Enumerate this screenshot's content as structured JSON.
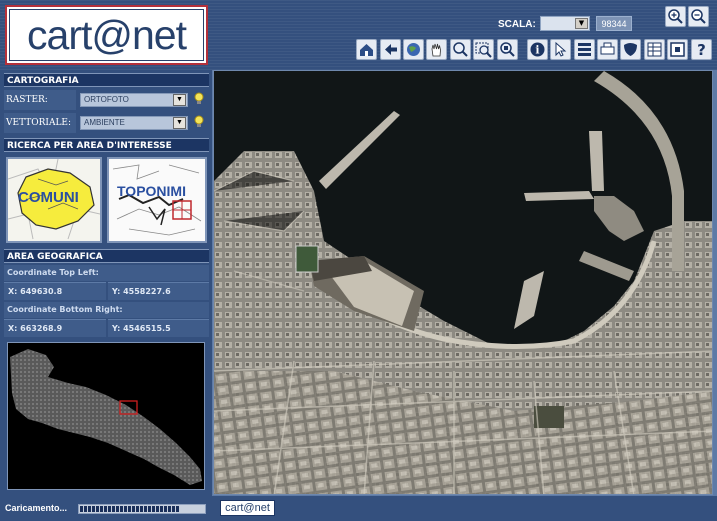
{
  "header": {
    "logo_text": "cart@net",
    "scale_label": "SCALA:",
    "scale_value": "98344",
    "toolbar": [
      {
        "name": "home-icon"
      },
      {
        "name": "back-arrow-icon"
      },
      {
        "name": "globe-icon"
      },
      {
        "name": "pan-hand-icon"
      },
      {
        "name": "zoom-icon"
      },
      {
        "name": "zoom-window-icon"
      },
      {
        "name": "zoom-extent-icon"
      },
      {
        "name": "info-icon"
      },
      {
        "name": "select-icon"
      },
      {
        "name": "legend-icon"
      },
      {
        "name": "print-icon"
      },
      {
        "name": "shield-icon"
      },
      {
        "name": "table-icon"
      },
      {
        "name": "window-icon"
      },
      {
        "name": "help-icon"
      }
    ]
  },
  "cartografia": {
    "title": "CARTOGRAFIA",
    "raster_label": "RASTER:",
    "raster_value": "ORTOFOTO",
    "vettoriale_label": "VETTORIALE:",
    "vettoriale_value": "AMBIENTE"
  },
  "ricerca": {
    "title": "RICERCA PER AREA D'INTERESSE",
    "comuni_label": "COMUNI",
    "toponimi_label": "TOPONIMI"
  },
  "area": {
    "title": "AREA GEOGRAFICA",
    "top_left_label": "Coordinate Top Left:",
    "tl_x": "X: 649630.8",
    "tl_y": "Y: 4558227.6",
    "bottom_right_label": "Coordinate Bottom Right:",
    "br_x": "X: 663268.9",
    "br_y": "Y: 4546515.5"
  },
  "status": {
    "loading_label": "Caricamento...",
    "progress_fraction": 0.8,
    "mini_logo_text": "cart@net"
  },
  "colors": {
    "panel_bg": "#34507e",
    "section_header": "#1c3563",
    "accent_red": "#b3303b"
  }
}
